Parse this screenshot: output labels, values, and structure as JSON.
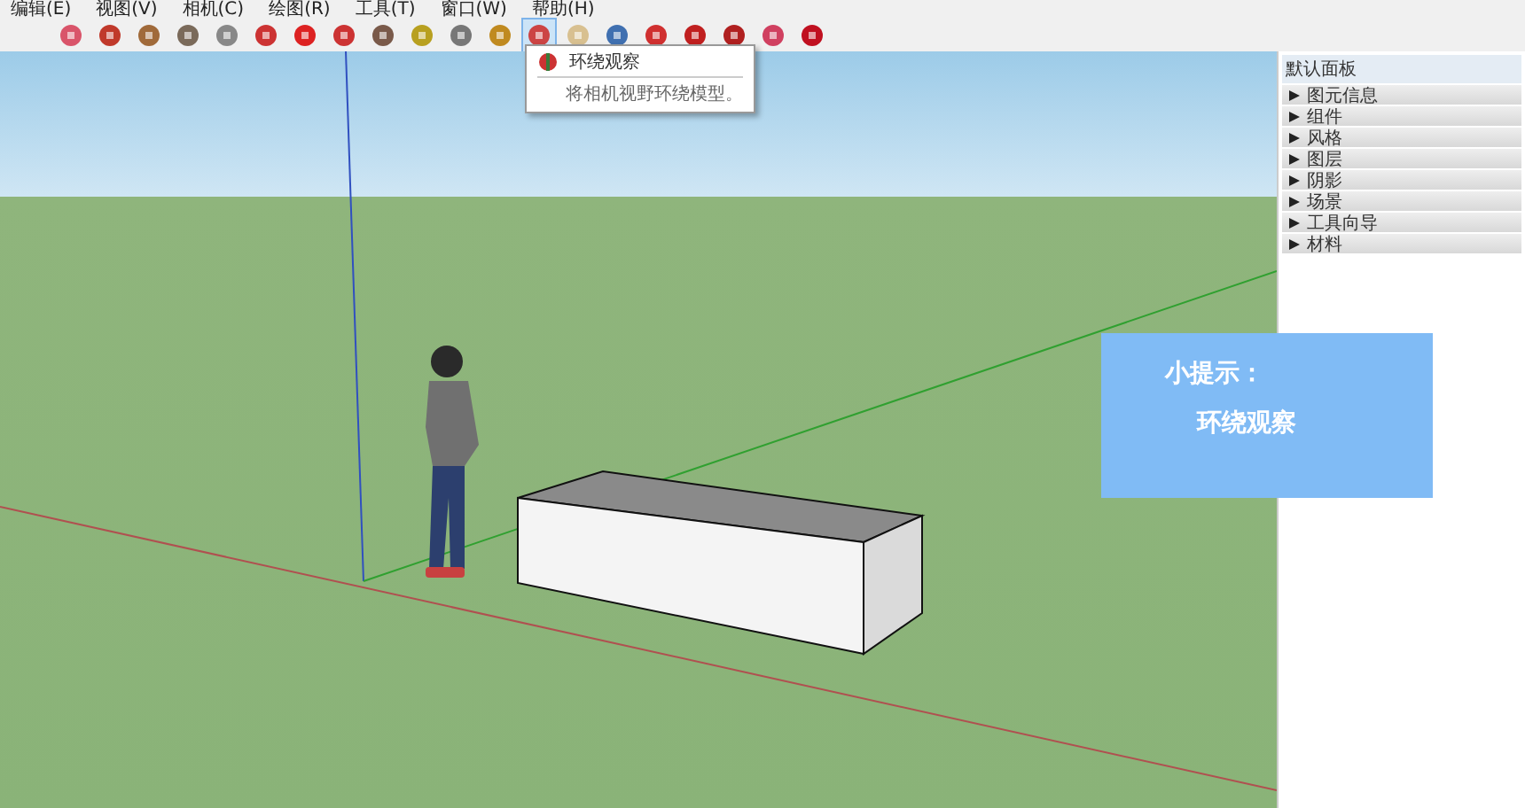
{
  "menu": [
    "编辑(E)",
    "视图(V)",
    "相机(C)",
    "绘图(R)",
    "工具(T)",
    "窗口(W)",
    "帮助(H)"
  ],
  "toolbar": [
    {
      "selected": false
    },
    {
      "selected": false
    },
    {
      "selected": false
    },
    {
      "selected": false
    },
    {
      "selected": false
    },
    {
      "selected": false
    },
    {
      "selected": false
    },
    {
      "selected": false
    },
    {
      "selected": false
    },
    {
      "selected": false
    },
    {
      "selected": false
    },
    {
      "selected": false
    },
    {
      "selected": true
    },
    {
      "selected": false
    },
    {
      "selected": false
    },
    {
      "selected": false
    },
    {
      "selected": false
    },
    {
      "selected": false
    },
    {
      "selected": false
    },
    {
      "selected": false
    }
  ],
  "tooltip": {
    "title": "环绕观察",
    "description": "将相机视野环绕模型。"
  },
  "panel": {
    "title": "默认面板",
    "items": [
      {
        "label": "图元信息",
        "expanded": false
      },
      {
        "label": "组件",
        "expanded": false
      },
      {
        "label": "风格",
        "expanded": false
      },
      {
        "label": "图层",
        "expanded": false
      },
      {
        "label": "阴影",
        "expanded": false
      },
      {
        "label": "场景",
        "expanded": false
      },
      {
        "label": "工具向导",
        "expanded": false
      },
      {
        "label": "材料",
        "expanded": false
      }
    ]
  },
  "hint": {
    "title": "小提示：",
    "text": "环绕观察"
  }
}
